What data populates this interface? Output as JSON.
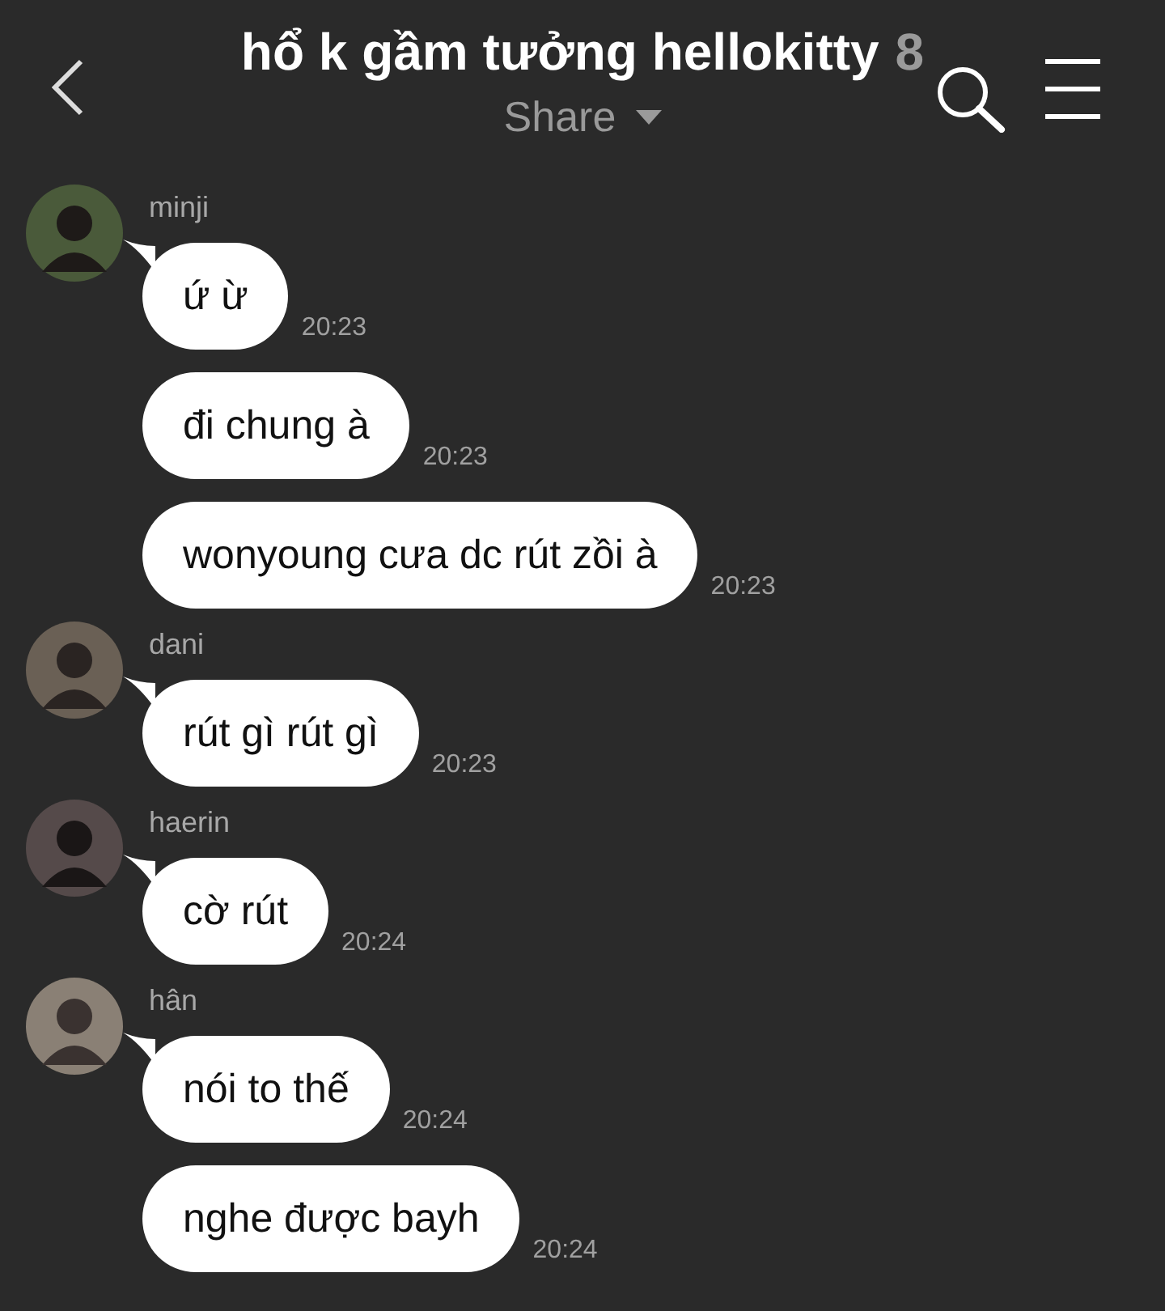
{
  "header": {
    "title": "hổ k gầm tưởng hellokitty",
    "member_count": "8",
    "subtitle": "Share"
  },
  "groups": [
    {
      "sender": "minji",
      "messages": [
        {
          "text": "ứ ừ",
          "time": "20:23"
        },
        {
          "text": "đi chung à",
          "time": "20:23"
        },
        {
          "text": "wonyoung cưa dc rút zồi à",
          "time": "20:23"
        }
      ]
    },
    {
      "sender": "dani",
      "messages": [
        {
          "text": "rút gì rút gì",
          "time": "20:23"
        }
      ]
    },
    {
      "sender": "haerin",
      "messages": [
        {
          "text": "cờ rút",
          "time": "20:24"
        }
      ]
    },
    {
      "sender": "hân",
      "messages": [
        {
          "text": "nói to thế",
          "time": "20:24"
        },
        {
          "text": "nghe được bayh",
          "time": "20:24"
        }
      ]
    }
  ]
}
